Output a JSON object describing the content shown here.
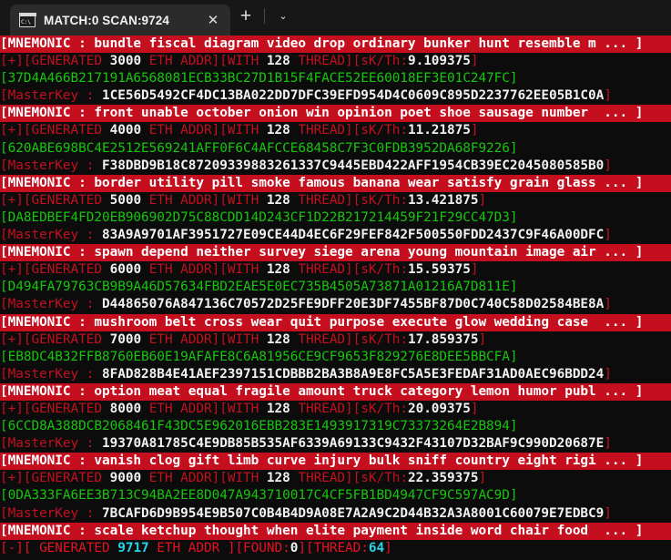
{
  "window": {
    "tab": {
      "icon": "console-icon",
      "icon_text": "C:\\",
      "title": "MATCH:0 SCAN:9724",
      "close_label": "✕"
    },
    "new_tab_label": "+",
    "dropdown_label": "⌄"
  },
  "terminal": {
    "labels": {
      "mnemonic_prefix": "[MNEMONIC : ",
      "mnemonic_suffix": "]",
      "gen_prefix": "[+][GENERATED ",
      "gen_mid1": " ETH ADDR][WITH ",
      "gen_mid2": " THREAD][sK/Th:",
      "gen_suffix": "]",
      "masterkey_prefix": "[MasterKey : ",
      "masterkey_suffix": "]",
      "addr_prefix": "[",
      "addr_suffix": "]"
    },
    "blocks": [
      {
        "mnemonic": "[MNEMONIC : bundle fiscal diagram video drop ordinary bunker hunt resemble m ... ]",
        "generated": "3000",
        "threads": "128",
        "rate": "9.109375",
        "address": "[37D4A466B217191A6568081ECB33BC27D1B15F4FACE52EE60018EF3E01C247FC]",
        "masterkey": "1CE56D5492CF4DC13BA022DD7DFC39EFD954D4C0609C895D2237762EE05B1C0A"
      },
      {
        "mnemonic": "[MNEMONIC : front unable october onion win opinion poet shoe sausage number  ... ]",
        "generated": "4000",
        "threads": "128",
        "rate": "11.21875",
        "address": "[620ABE698BC4E2512E569241AFF0F6C4AFCCE68458C7F3C0FDB3952DA68F9226]",
        "masterkey": "F38DBD9B18C87209339883261337C9445EBD422AFF1954CB39EC2045080585B0"
      },
      {
        "mnemonic": "[MNEMONIC : border utility pill smoke famous banana wear satisfy grain glass ... ]",
        "generated": "5000",
        "threads": "128",
        "rate": "13.421875",
        "address": "[DA8EDBEF4FD20EB906902D75C88CDD14D243CF1D22B217214459F21F29CC47D3]",
        "masterkey": "83A9A9701AF3951727E09CE44D4EC6F29FEF842F500550FDD2437C9F46A00DFC"
      },
      {
        "mnemonic": "[MNEMONIC : spawn depend neither survey siege arena young mountain image air ... ]",
        "generated": "6000",
        "threads": "128",
        "rate": "15.59375",
        "address": "[D494FA79763CB9B9A46D57634FBD2EAE5E0EC735B4505A73871A01216A7D811E]",
        "masterkey": "D44865076A847136C70572D25FE9DFF20E3DF7455BF87D0C740C58D02584BE8A"
      },
      {
        "mnemonic": "[MNEMONIC : mushroom belt cross wear quit purpose execute glow wedding case  ... ]",
        "generated": "7000",
        "threads": "128",
        "rate": "17.859375",
        "address": "[EB8DC4B32FFB8760EB60E19AFAFE8C6A81956CE9CF9653F829276E8DEE5BBCFA]",
        "masterkey": "8FAD828B4E41AEF2397151CDBBB2BA3B8A9E8FC5A5E3FEDAF31AD0AEC96BDD24"
      },
      {
        "mnemonic": "[MNEMONIC : option meat equal fragile amount truck category lemon humor publ ... ]",
        "generated": "8000",
        "threads": "128",
        "rate": "20.09375",
        "address": "[6CCD8A388DCB2068461F43DC5E962016EBB283E1493917319C73373264E2B894]",
        "masterkey": "19370A81785C4E9DB85B535AF6339A69133C9432F43107D32BAF9C990D20687E"
      },
      {
        "mnemonic": "[MNEMONIC : vanish clog gift limb curve injury bulk sniff country eight rigi ... ]",
        "generated": "9000",
        "threads": "128",
        "rate": "22.359375",
        "address": "[0DA333FA6EE3B713C94BA2EE8D047A943710017C4CF5FB1BD4947CF9C597AC9D]",
        "masterkey": "7BCAFD6D9B954E9B507C0B4B4D9A08E7A2A9C2D44B32A3A8001C60079E7EDBC9"
      }
    ],
    "final_mnemonic": "[MNEMONIC : scale ketchup thought when elite payment inside word chair food  ... ]",
    "status": {
      "prefix": "[-][ GENERATED ",
      "generated": "9717",
      "mid": " ETH ADDR ][FOUND:",
      "found": "0",
      "mid2": "][THREAD:",
      "threads": "64",
      "suffix": "]"
    }
  },
  "colors": {
    "banner_red": "#c50f1f",
    "bright_red": "#e81123",
    "green": "#16c60c",
    "cyan": "#29d3e8",
    "white": "#f2f2f2",
    "terminal_bg": "#0c0c0c",
    "titlebar_bg": "#171717",
    "tab_bg": "#2b2b2b"
  }
}
